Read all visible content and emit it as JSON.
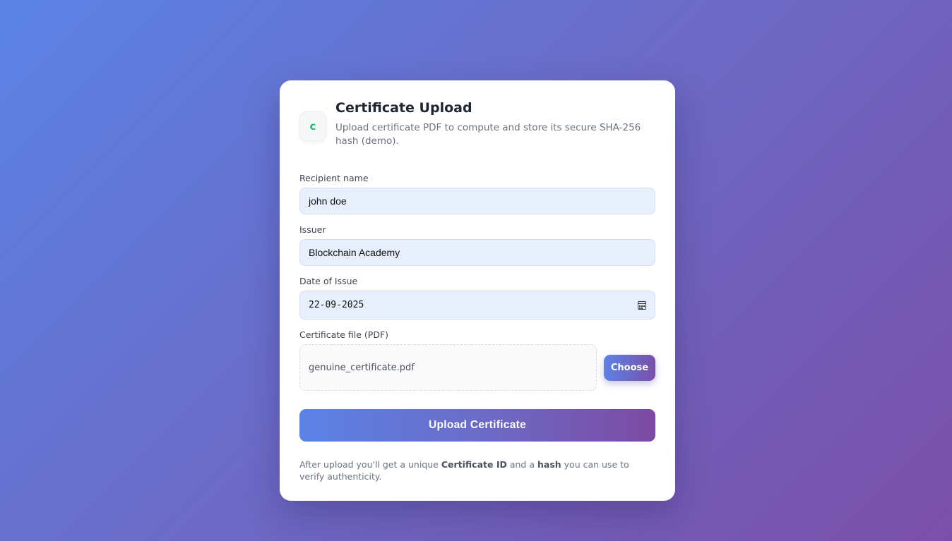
{
  "header": {
    "logo_letter": "c",
    "title": "Certificate Upload",
    "subtitle": "Upload certificate PDF to compute and store its secure SHA-256 hash (demo)."
  },
  "form": {
    "recipient": {
      "label": "Recipient name",
      "value": "john doe"
    },
    "issuer": {
      "label": "Issuer",
      "value": "Blockchain Academy"
    },
    "date": {
      "label": "Date of Issue",
      "value": "22-09-2025",
      "icon": "calendar-icon"
    },
    "file": {
      "label": "Certificate file (PDF)",
      "value": "genuine_certificate.pdf",
      "button": "Choose"
    }
  },
  "submit_label": "Upload Certificate",
  "note": {
    "prefix": "After upload you'll get a unique ",
    "id_term": "Certificate ID",
    "middle": " and a ",
    "hash_term": "hash",
    "suffix": " you can use to verify authenticity."
  },
  "colors": {
    "gradient_start": "#5b83e6",
    "gradient_end": "#7a4fa8",
    "logo_green": "#16c172",
    "input_bg": "#e6effb"
  }
}
